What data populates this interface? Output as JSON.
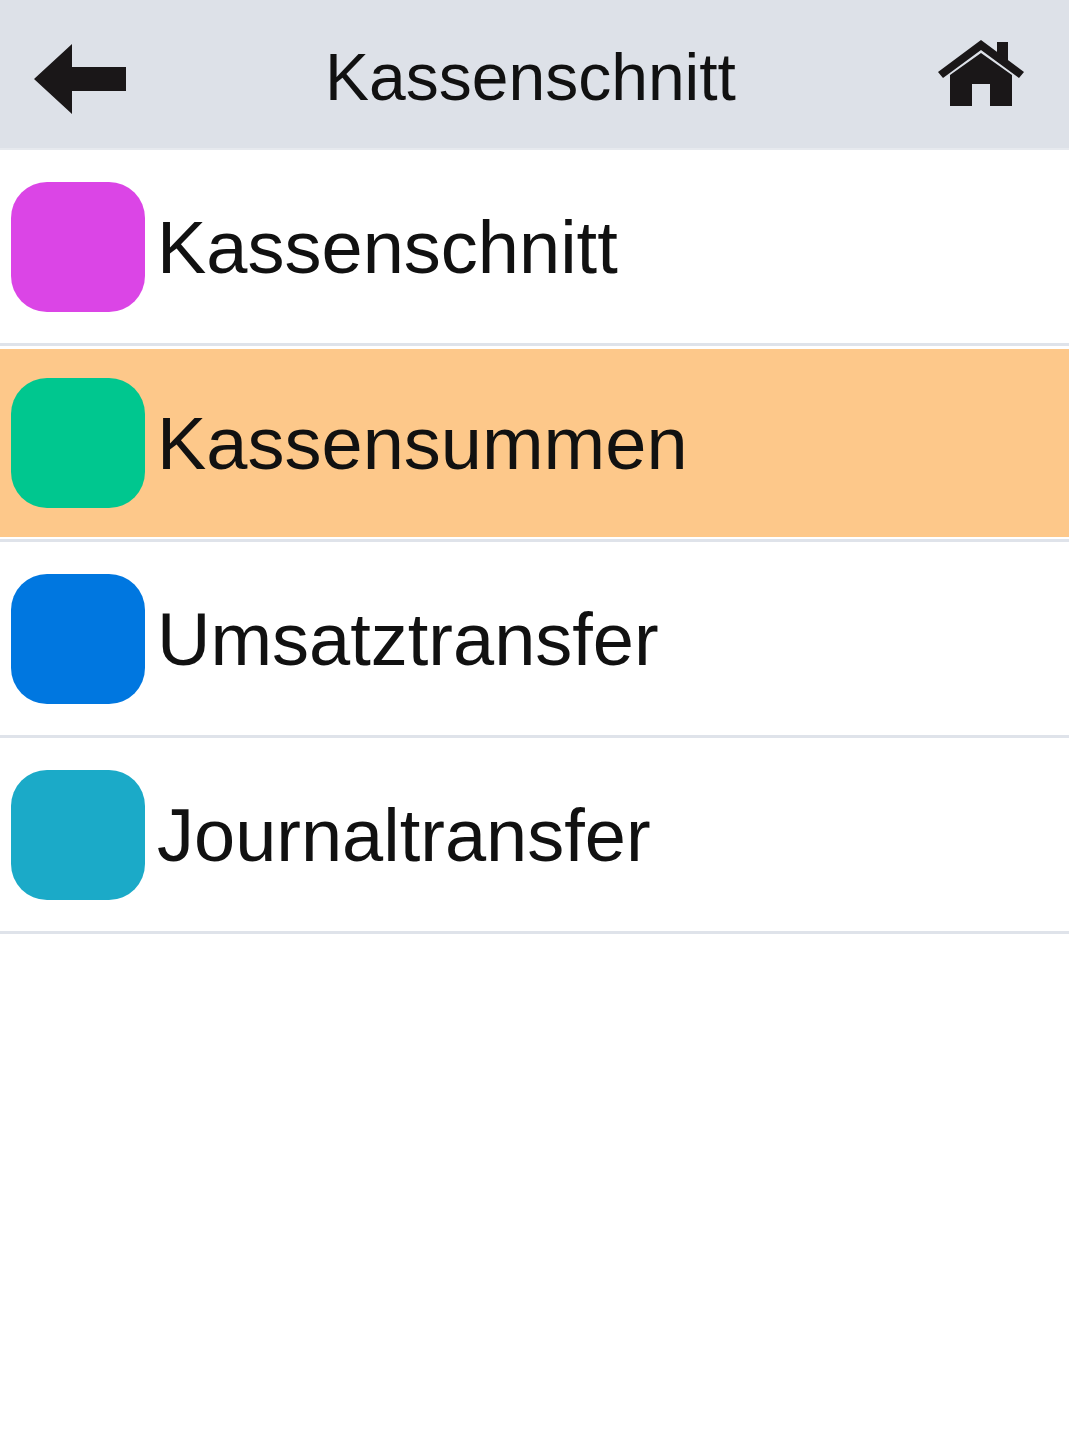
{
  "header": {
    "title": "Kassenschnitt"
  },
  "items": [
    {
      "label": "Kassenschnitt",
      "color": "#db45e6",
      "selected": false
    },
    {
      "label": "Kassensummen",
      "color": "#00c78f",
      "selected": true
    },
    {
      "label": "Umsatztransfer",
      "color": "#0077e0",
      "selected": false
    },
    {
      "label": "Journaltransfer",
      "color": "#1baac8",
      "selected": false
    }
  ]
}
